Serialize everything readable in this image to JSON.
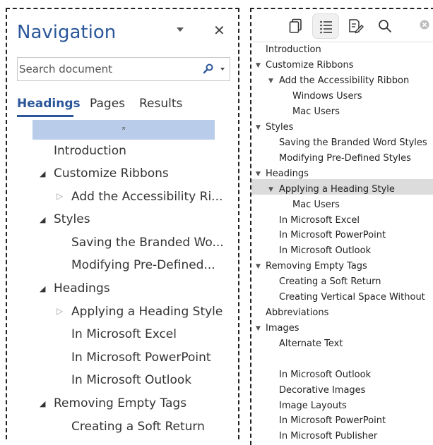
{
  "left": {
    "title": "Navigation",
    "search_placeholder": "Search document",
    "tabs": [
      "Headings",
      "Pages",
      "Results"
    ],
    "highlight_glyph": "⌅",
    "items": [
      {
        "label": "Introduction"
      },
      {
        "label": "Customize Ribbons"
      },
      {
        "label": "Add the Accessibility Ri..."
      },
      {
        "label": "Styles"
      },
      {
        "label": "Saving the Branded Wo..."
      },
      {
        "label": "Modifying Pre-Defined..."
      },
      {
        "label": "Headings"
      },
      {
        "label": "Applying a Heading Style"
      },
      {
        "label": "In Microsoft Excel"
      },
      {
        "label": "In Microsoft PowerPoint"
      },
      {
        "label": "In Microsoft Outlook"
      },
      {
        "label": "Removing Empty Tags"
      },
      {
        "label": "Creating a Soft Return"
      }
    ]
  },
  "right": {
    "toolbar": [
      "thumbnails-icon",
      "outline-icon",
      "markup-icon",
      "search-icon",
      "close-icon"
    ],
    "items": [
      {
        "label": "Introduction"
      },
      {
        "label": "Customize Ribbons"
      },
      {
        "label": "Add the Accessibility Ribbon"
      },
      {
        "label": "Windows Users"
      },
      {
        "label": "Mac Users"
      },
      {
        "label": "Styles"
      },
      {
        "label": "Saving the Branded Word Styles"
      },
      {
        "label": "Modifying Pre-Defined Styles"
      },
      {
        "label": "Headings"
      },
      {
        "label": "Applying a Heading Style"
      },
      {
        "label": "Mac Users"
      },
      {
        "label": "In Microsoft Excel"
      },
      {
        "label": "In Microsoft PowerPoint"
      },
      {
        "label": "In Microsoft Outlook"
      },
      {
        "label": "Removing Empty Tags"
      },
      {
        "label": "Creating a Soft Return"
      },
      {
        "label": "Creating Vertical Space Without"
      },
      {
        "label": "Abbreviations"
      },
      {
        "label": "Images"
      },
      {
        "label": "Alternate Text"
      },
      {
        "label": "In Microsoft Outlook"
      },
      {
        "label": "Decorative Images"
      },
      {
        "label": "Image Layouts"
      },
      {
        "label": "In Microsoft PowerPoint"
      },
      {
        "label": "In Microsoft Publisher"
      }
    ]
  }
}
